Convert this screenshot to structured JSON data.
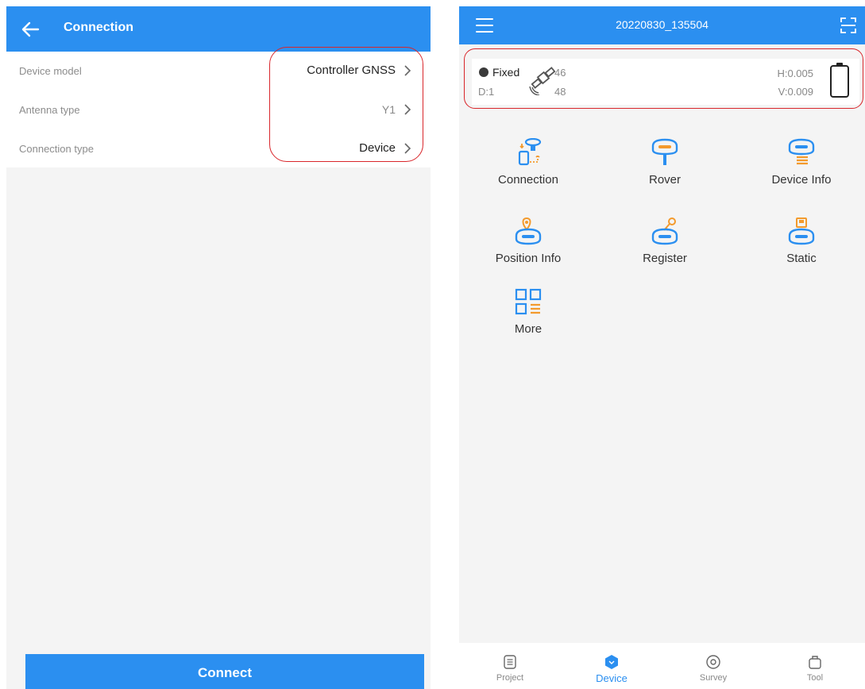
{
  "left": {
    "header": {
      "title": "Connection"
    },
    "settings": [
      {
        "label": "Device model",
        "value": "Controller GNSS"
      },
      {
        "label": "Antenna type",
        "value": "Y1"
      },
      {
        "label": "Connection type",
        "value": "Device"
      }
    ],
    "connect_label": "Connect"
  },
  "right": {
    "header": {
      "title": "20220830_135504"
    },
    "status": {
      "fix": "Fixed",
      "diff_age": "D:1",
      "satellites_used": "46",
      "satellites_total": "48",
      "h_precision": "H:0.005",
      "v_precision": "V:0.009"
    },
    "tiles": [
      {
        "label": "Connection",
        "icon": "connection-icon"
      },
      {
        "label": "Rover",
        "icon": "rover-icon"
      },
      {
        "label": "Device Info",
        "icon": "device-info-icon"
      },
      {
        "label": "Position Info",
        "icon": "position-info-icon"
      },
      {
        "label": "Register",
        "icon": "register-icon"
      },
      {
        "label": "Static",
        "icon": "static-icon"
      },
      {
        "label": "More",
        "icon": "more-icon"
      }
    ],
    "nav": [
      {
        "label": "Project",
        "icon": "project-icon",
        "active": false
      },
      {
        "label": "Device",
        "icon": "device-icon",
        "active": true
      },
      {
        "label": "Survey",
        "icon": "survey-icon",
        "active": false
      },
      {
        "label": "Tool",
        "icon": "tool-icon",
        "active": false
      }
    ]
  },
  "colors": {
    "primary": "#2b8ff0",
    "accent": "#f39a2c",
    "highlight": "#d9262b",
    "background": "#f4f4f4"
  }
}
